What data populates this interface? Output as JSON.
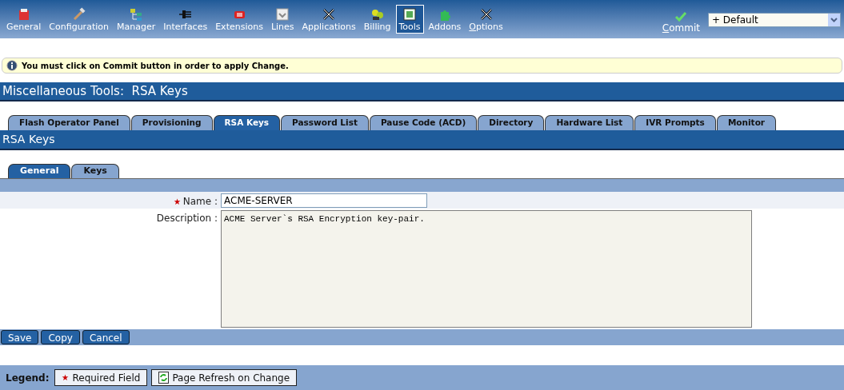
{
  "toolbar": {
    "items": [
      {
        "label": "General",
        "selected": false,
        "underline_first": false
      },
      {
        "label": "Configuration",
        "selected": false,
        "underline_first": false
      },
      {
        "label": "Manager",
        "selected": false,
        "underline_first": false
      },
      {
        "label": "Interfaces",
        "selected": false,
        "underline_first": false
      },
      {
        "label": "Extensions",
        "selected": false,
        "underline_first": false
      },
      {
        "label": "Lines",
        "selected": false,
        "underline_first": false
      },
      {
        "label": "Applications",
        "selected": false,
        "underline_first": false
      },
      {
        "label": "Billing",
        "selected": false,
        "underline_first": false
      },
      {
        "label": "Tools",
        "selected": true,
        "underline_first": false
      },
      {
        "label": "Addons",
        "selected": false,
        "underline_first": false
      },
      {
        "label": "Options",
        "selected": false,
        "underline_first": true
      }
    ],
    "commit": {
      "label": "Commit",
      "underline_first": true
    },
    "profile_select": {
      "value": "+ Default"
    }
  },
  "notice": "You must click on Commit button in order to apply Change.",
  "page_title": "Miscellaneous Tools:  RSA Keys",
  "tabs": [
    {
      "label": "Flash Operator Panel",
      "selected": false
    },
    {
      "label": "Provisioning",
      "selected": false
    },
    {
      "label": "RSA Keys",
      "selected": true
    },
    {
      "label": "Password List",
      "selected": false
    },
    {
      "label": "Pause Code (ACD)",
      "selected": false
    },
    {
      "label": "Directory",
      "selected": false
    },
    {
      "label": "Hardware List",
      "selected": false
    },
    {
      "label": "IVR Prompts",
      "selected": false
    },
    {
      "label": "Monitor",
      "selected": false
    }
  ],
  "section_title": "RSA Keys",
  "subtabs": [
    {
      "label": "General",
      "selected": true
    },
    {
      "label": "Keys",
      "selected": false
    }
  ],
  "form": {
    "fields": [
      {
        "kind": "text",
        "label": "Name :",
        "required": true,
        "value": "ACME-SERVER"
      },
      {
        "kind": "textarea",
        "label": "Description :",
        "required": false,
        "value": "ACME Server`s RSA Encryption key-pair."
      }
    ]
  },
  "buttons": [
    "Save",
    "Copy",
    "Cancel"
  ],
  "legend": {
    "label": "Legend:",
    "items": [
      {
        "kind": "required",
        "label": "Required Field"
      },
      {
        "kind": "refresh",
        "label": "Page Refresh on Change"
      }
    ]
  }
}
